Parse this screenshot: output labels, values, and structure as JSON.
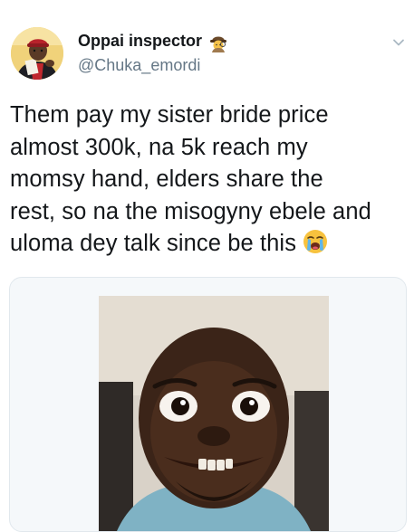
{
  "tweet": {
    "display_name": "Oppai inspector",
    "name_emoji_icon": "detective-emoji-icon",
    "handle": "@Chuka_emordi",
    "text_lines": [
      "Them pay my sister bride price",
      "almost 300k, na 5k reach my",
      "momsy hand, elders share the",
      "rest, so na the misogyny ebele and",
      "uloma dey talk since be this"
    ],
    "trailing_emoji_icon": "loudly-crying-face-emoji-icon",
    "menu_icon": "chevron-down-icon",
    "media_icon": "meme-photo"
  },
  "colors": {
    "text_primary": "#14171a",
    "text_secondary": "#657786",
    "card_border": "#e1e8ed",
    "card_bg": "#f5f8fa"
  }
}
